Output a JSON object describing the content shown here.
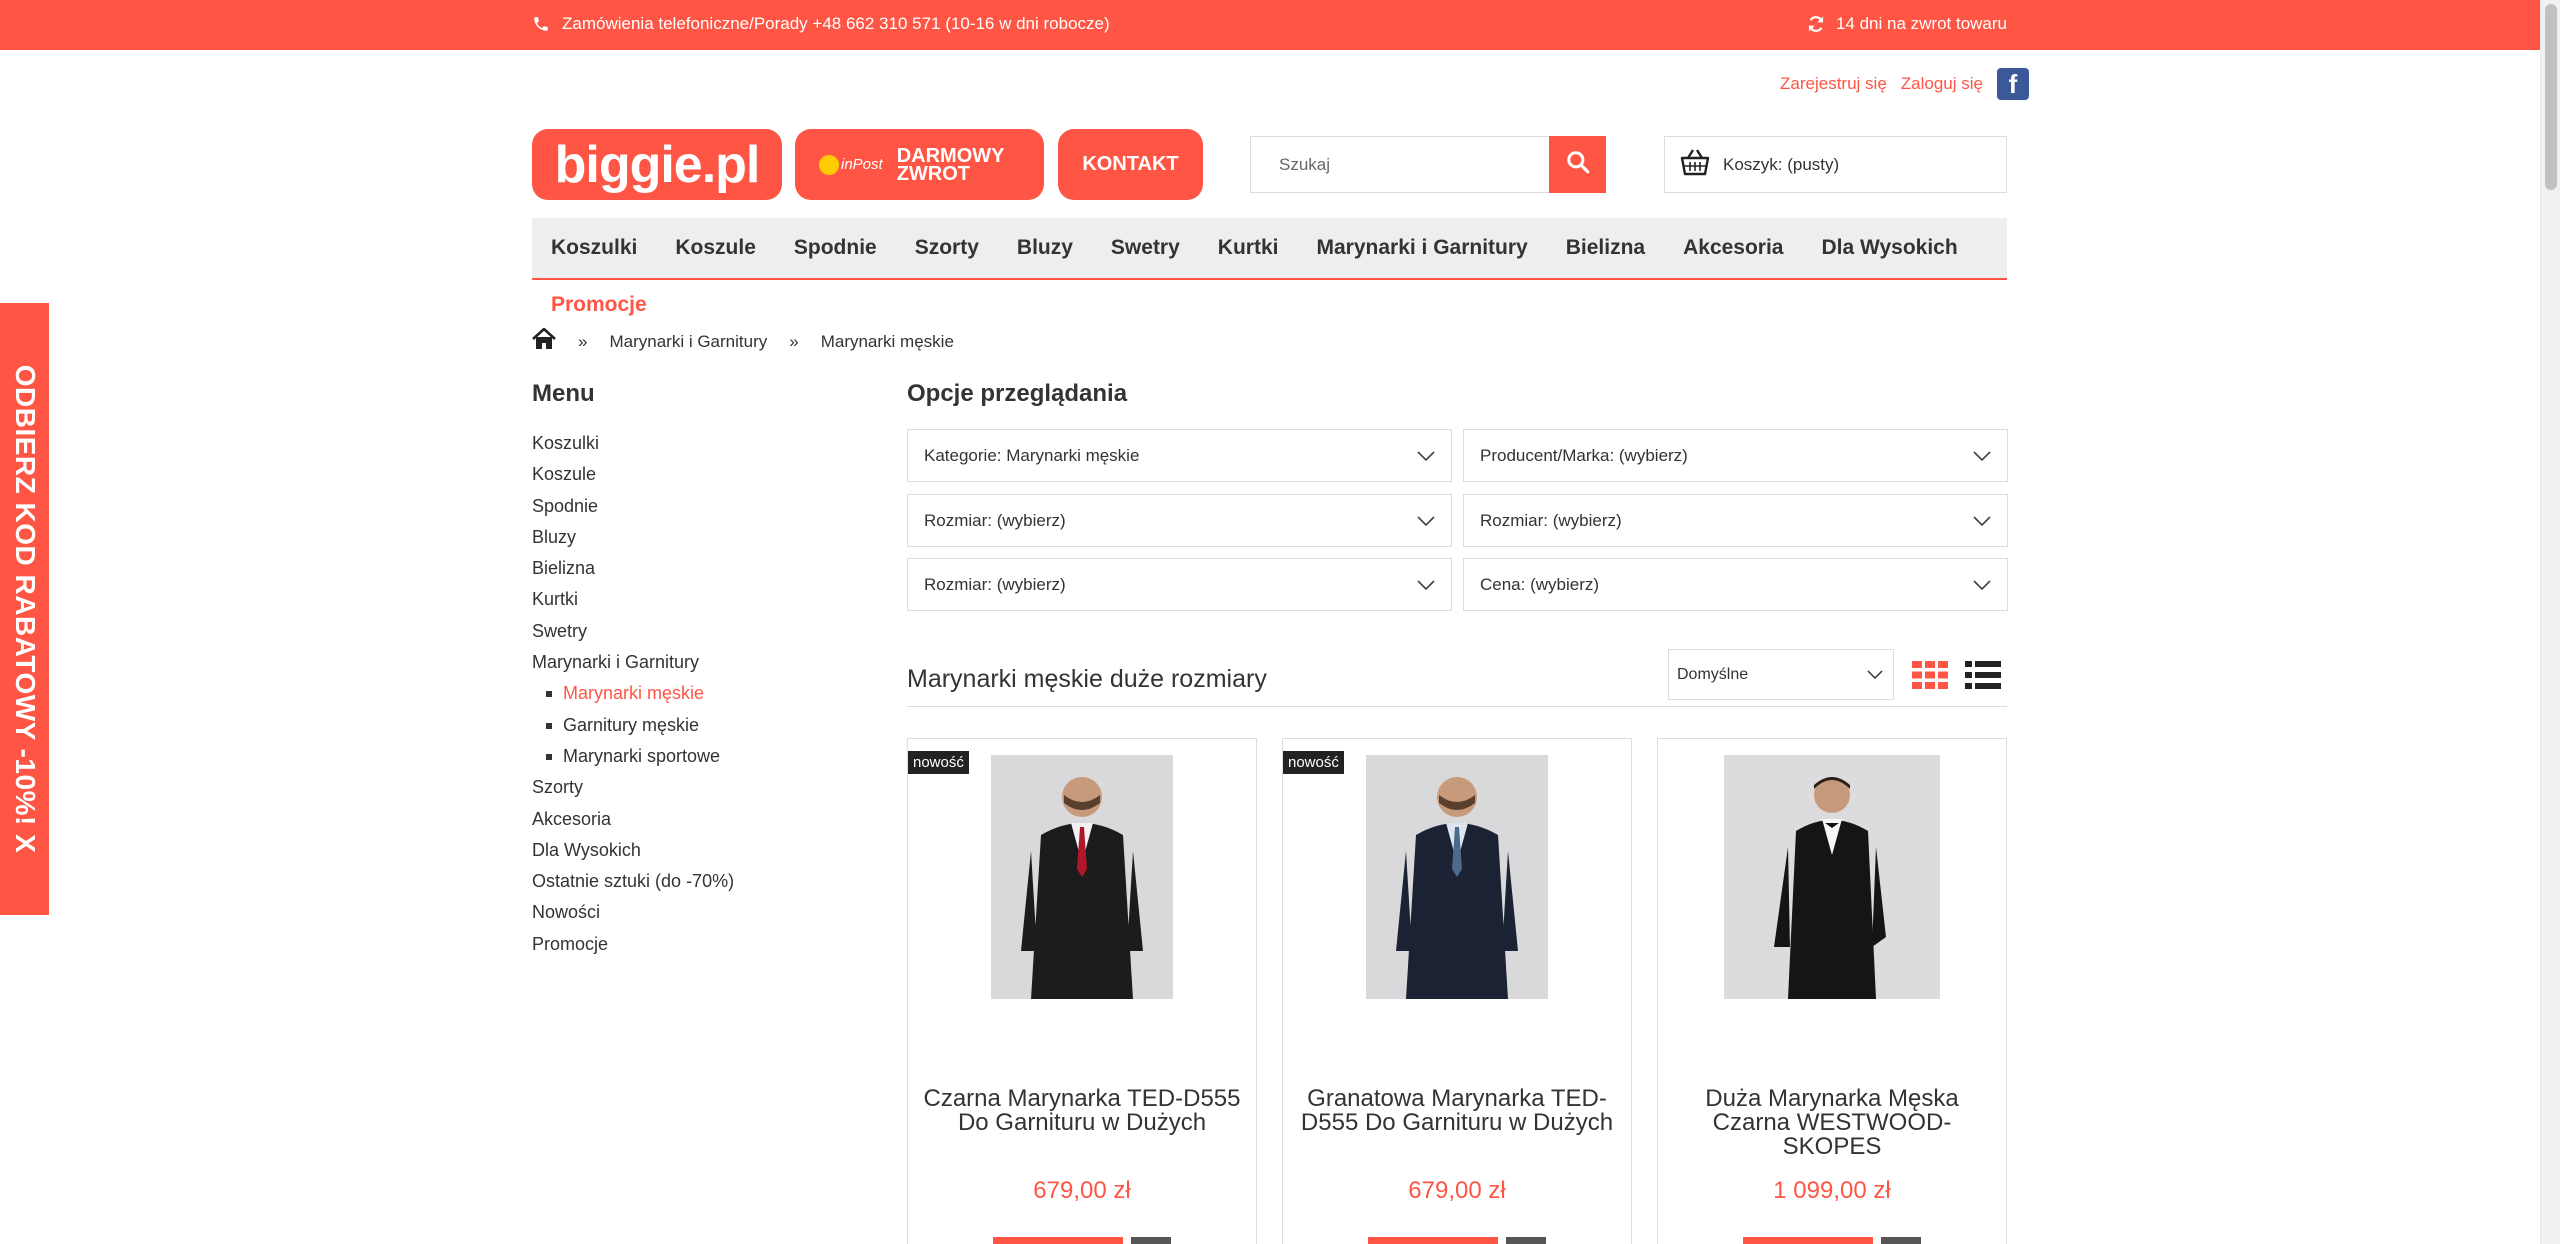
{
  "topbar": {
    "phone_icon": "phone-icon",
    "phone_text": "Zamówienia telefoniczne/Porady +48 662 310 571 (10-16 w dni robocze)",
    "return_icon": "refresh-icon",
    "return_text": "14 dni na zwrot towaru"
  },
  "account": {
    "register": "Zarejestruj się",
    "login": "Zaloguj się",
    "facebook_letter": "f"
  },
  "header": {
    "logo": "biggie.pl",
    "inpost_brand": "inPost",
    "inpost_line1": "DARMOWY",
    "inpost_line2": "ZWROT",
    "contact": "KONTAKT"
  },
  "search": {
    "placeholder": "Szukaj",
    "icon": "search-icon"
  },
  "cart": {
    "label": "Koszyk: (pusty)",
    "icon": "basket-icon"
  },
  "nav": {
    "items": [
      "Koszulki",
      "Koszule",
      "Spodnie",
      "Szorty",
      "Bluzy",
      "Swetry",
      "Kurtki",
      "Marynarki i Garnitury",
      "Bielizna",
      "Akcesoria",
      "Dla Wysokich"
    ],
    "promo": "Promocje"
  },
  "breadcrumb": {
    "home_icon": "home-icon",
    "sep": "»",
    "items": [
      "Marynarki i Garnitury",
      "Marynarki męskie"
    ]
  },
  "sidebar": {
    "title": "Menu",
    "items": [
      {
        "label": "Koszulki"
      },
      {
        "label": "Koszule"
      },
      {
        "label": "Spodnie"
      },
      {
        "label": "Bluzy"
      },
      {
        "label": "Bielizna"
      },
      {
        "label": "Kurtki"
      },
      {
        "label": "Swetry"
      },
      {
        "label": "Marynarki i Garnitury"
      },
      {
        "label": "Marynarki męskie",
        "sub": true,
        "active": true
      },
      {
        "label": "Garnitury męskie",
        "sub": true
      },
      {
        "label": "Marynarki sportowe",
        "sub": true
      },
      {
        "label": "Szorty"
      },
      {
        "label": "Akcesoria"
      },
      {
        "label": "Dla Wysokich"
      },
      {
        "label": "Ostatnie sztuki (do -70%)"
      },
      {
        "label": "Nowości"
      },
      {
        "label": "Promocje"
      }
    ]
  },
  "filters": {
    "title": "Opcje przeglądania",
    "items": [
      "Kategorie: Marynarki męskie",
      "Producent/Marka: (wybierz)",
      "Rozmiar: (wybierz)",
      "Rozmiar: (wybierz)",
      "Rozmiar: (wybierz)",
      "Cena: (wybierz)"
    ]
  },
  "listing": {
    "title": "Marynarki męskie duże rozmiary",
    "sort": "Domyślne",
    "grid_icon": "grid-view-icon",
    "list_icon": "list-view-icon"
  },
  "products": [
    {
      "badge": "nowość",
      "name": "Czarna Marynarka TED-D555 Do Garnituru w Dużych",
      "price": "679,00 zł",
      "suit": "#1c1c1e",
      "tie": "#b0182a",
      "shirt": "#f2f2f2"
    },
    {
      "badge": "nowość",
      "name": "Granatowa Marynarka TED-D555 Do Garnituru w Dużych",
      "price": "679,00 zł",
      "suit": "#1a2233",
      "tie": "#4d6a8c",
      "shirt": "#dde6ef"
    },
    {
      "badge": "",
      "name": "Duża Marynarka Męska Czarna WESTWOOD-SKOPES",
      "price": "1 099,00 zł",
      "suit": "#151515",
      "tie": "#101010",
      "shirt": "#f7f7f7"
    }
  ],
  "sidetab": {
    "text": "ODBIERZ KOD RABATOWY -10%!  X"
  },
  "colors": {
    "accent": "#ff5544",
    "text": "#333333",
    "border": "#dddddd",
    "nav_bg": "#eeeeee"
  }
}
